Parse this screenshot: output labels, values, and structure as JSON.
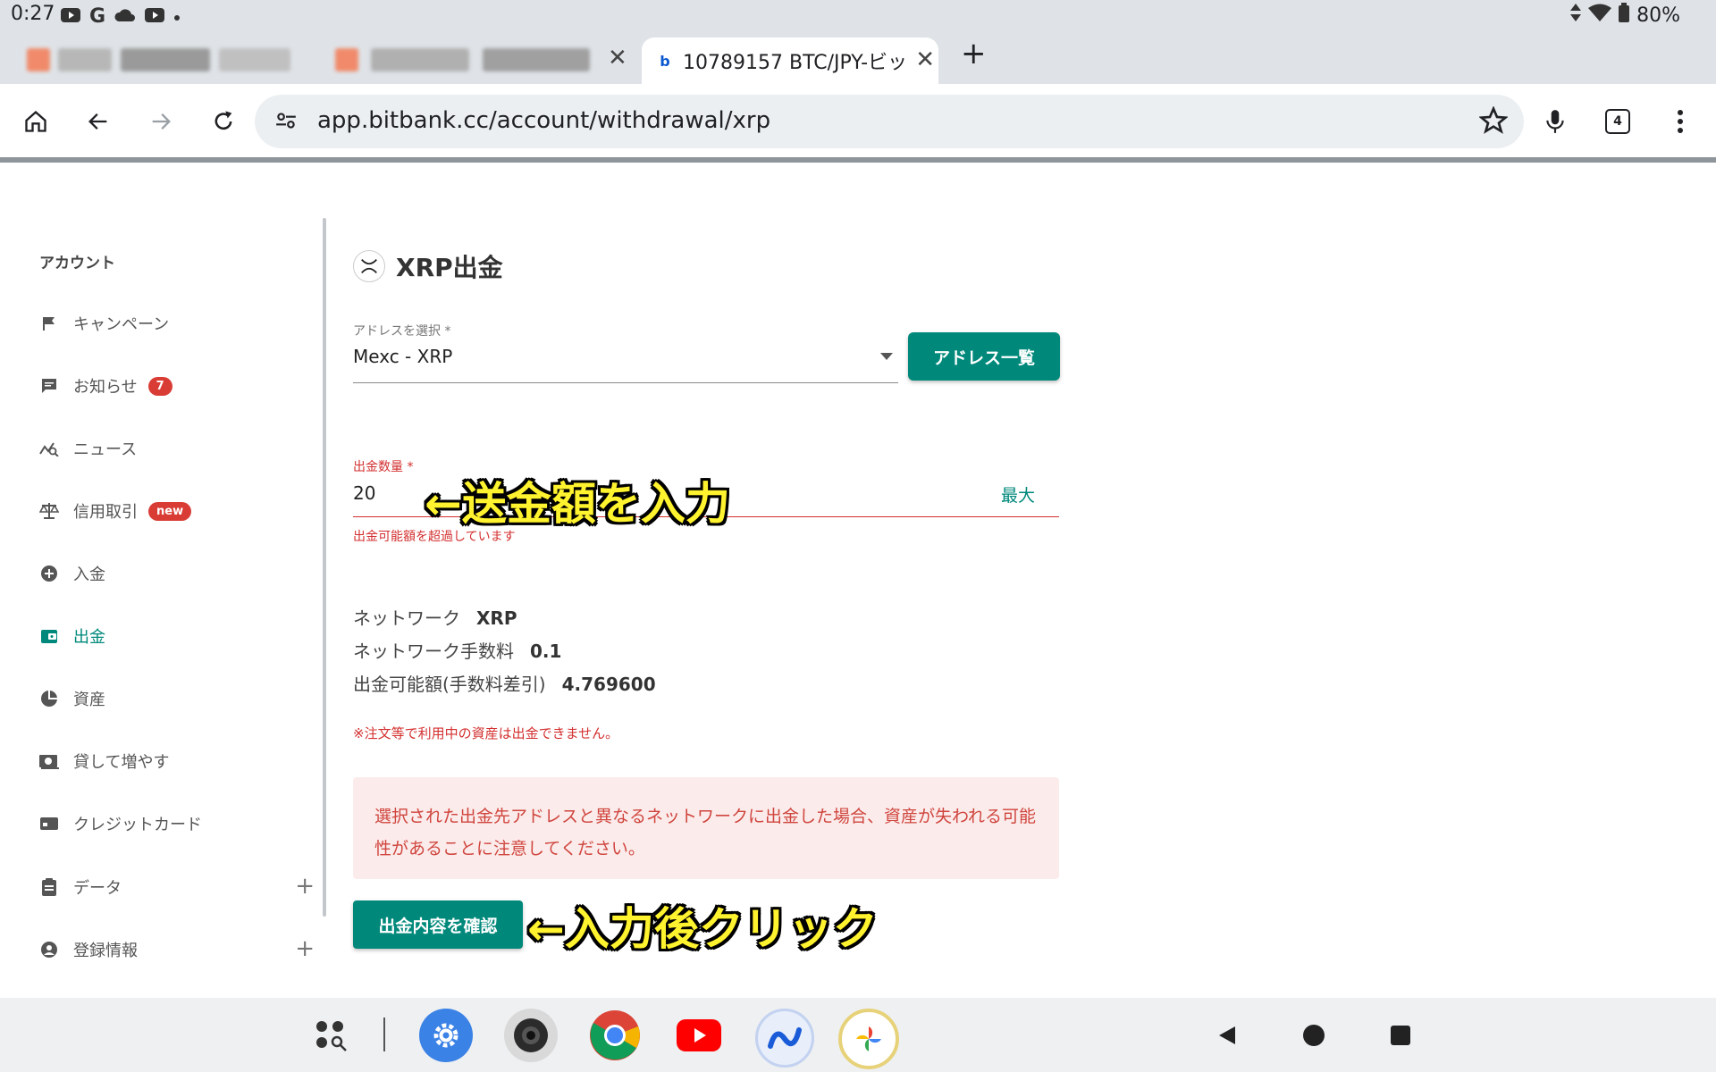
{
  "status_bar": {
    "time": "0:27",
    "battery": "80%",
    "icons": [
      "youtube-icon",
      "google-icon",
      "cloud-icon",
      "youtube-icon",
      "dot-icon",
      "signal-icon",
      "wifi-icon",
      "battery-icon"
    ]
  },
  "tabs": {
    "active_title": "10789157 BTC/JPY-ビッ"
  },
  "toolbar": {
    "url": "app.bitbank.cc/account/withdrawal/xrp",
    "tab_count": "4"
  },
  "sidebar": {
    "title": "アカウント",
    "items": [
      {
        "label": "キャンペーン",
        "icon": "flag-icon"
      },
      {
        "label": "お知らせ",
        "icon": "message-icon",
        "badge": "7"
      },
      {
        "label": "ニュース",
        "icon": "news-icon"
      },
      {
        "label": "信用取引",
        "icon": "scale-icon",
        "badge": "new"
      },
      {
        "label": "入金",
        "icon": "plus-circle-icon"
      },
      {
        "label": "出金",
        "icon": "wallet-icon",
        "active": true
      },
      {
        "label": "資産",
        "icon": "pie-icon"
      },
      {
        "label": "貸して増やす",
        "icon": "lend-icon"
      },
      {
        "label": "クレジットカード",
        "icon": "card-icon"
      },
      {
        "label": "データ",
        "icon": "clipboard-icon",
        "expand": "+"
      },
      {
        "label": "登録情報",
        "icon": "account-icon",
        "expand": "+"
      }
    ]
  },
  "main": {
    "title": "XRP出金",
    "address": {
      "label": "アドレスを選択 *",
      "value": "Mexc - XRP",
      "button": "アドレス一覧"
    },
    "amount": {
      "label": "出金数量 *",
      "value": "20",
      "max": "最大",
      "error": "出金可能額を超過しています"
    },
    "network": {
      "label": "ネットワーク",
      "value": "XRP"
    },
    "fee": {
      "label": "ネットワーク手数料",
      "value": "0.1"
    },
    "available": {
      "label": "出金可能額(手数料差引)",
      "value": "4.769600"
    },
    "note": "※注文等で利用中の資産は出金できません。",
    "warning": "選択された出金先アドレスと異なるネットワークに出金した場合、資産が失われる可能性があることに注意してください。",
    "confirm_button": "出金内容を確認"
  },
  "annotations": {
    "amount": "←送金額を入力",
    "confirm": "←入力後クリック"
  },
  "colors": {
    "accent": "#00897b",
    "error": "#d32f2f",
    "annotation": "#fff22e"
  }
}
